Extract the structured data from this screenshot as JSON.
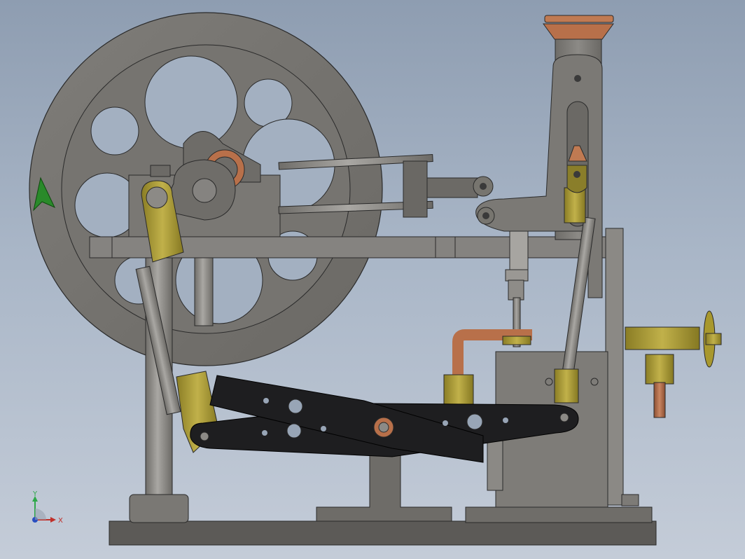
{
  "viewport": {
    "background_top": "#8e9db1",
    "background_bottom": "#c4ccd8"
  },
  "colors": {
    "steel": "#7d7b77",
    "steel_dark": "#5c5a57",
    "steel_light": "#9a9894",
    "brass": "#b3a23d",
    "copper": "#b8704a",
    "linkage": "#1e1e20",
    "orientation_arrow": "#2a8a2a"
  },
  "model": {
    "parts": [
      "flywheel",
      "frame-table",
      "crankshaft-bearing",
      "connecting-rods",
      "crosshead",
      "beam-column",
      "walking-beam",
      "cylinder",
      "steam-valve",
      "handwheel",
      "base-plate"
    ]
  },
  "triad": {
    "x_label": "X",
    "y_label": "Y",
    "x_color": "#c0302a",
    "y_color": "#2fa84a",
    "z_color": "#2a4fc0"
  }
}
